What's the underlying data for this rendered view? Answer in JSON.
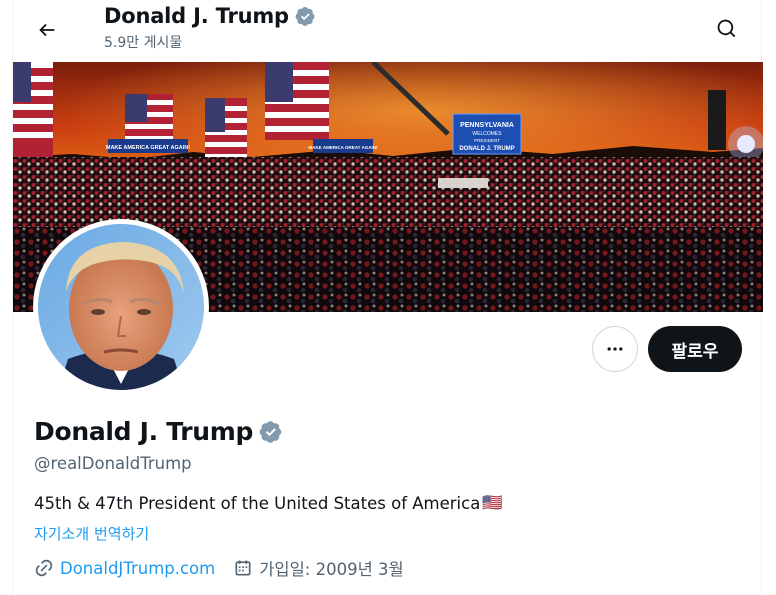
{
  "header": {
    "title": "Donald J. Trump",
    "post_count": "5.9만 게시물"
  },
  "profile": {
    "name": "Donald J. Trump",
    "handle": "@realDonaldTrump",
    "bio": "45th & 47th President of the United States of America",
    "bio_flag": "🇺🇸",
    "translate_label": "자기소개 번역하기",
    "website": "DonaldJTrump.com",
    "joined": "가입일: 2009년 3월"
  },
  "actions": {
    "follow_label": "팔로우"
  },
  "banner": {
    "signs": [
      "MAKE AMERICA GREAT AGAIN!",
      "MAKE AMERICA GREAT AGAIN!",
      "PENNSYLVANIA",
      "WELCOMES",
      "PRESIDENT",
      "DONALD J. TRUMP"
    ]
  },
  "colors": {
    "accent": "#1d9bf0",
    "text": "#0f1419",
    "secondary": "#536471",
    "verified": "#829aab"
  },
  "icons": [
    "back-arrow-icon",
    "search-icon",
    "verified-badge-icon",
    "more-icon",
    "link-icon",
    "calendar-icon"
  ]
}
